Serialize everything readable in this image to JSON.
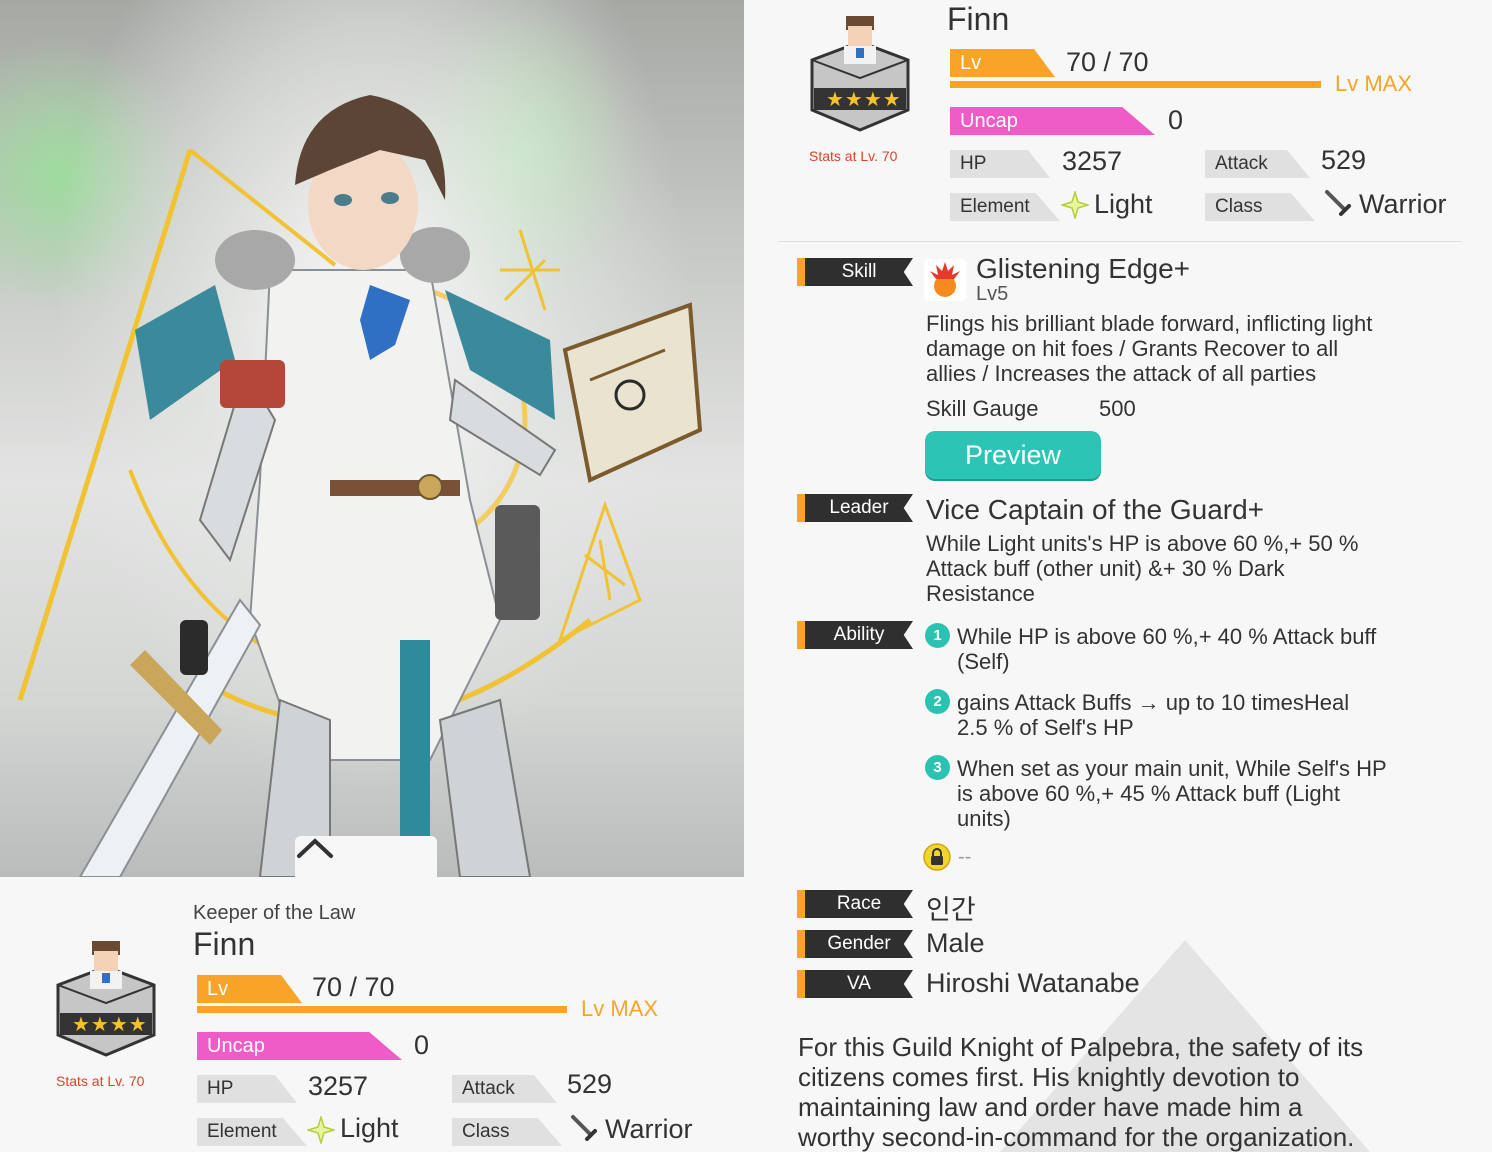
{
  "left": {
    "subtitle": "Keeper of the Law",
    "name": "Finn",
    "stars": "★★★★",
    "stats_at": "Stats at Lv. 70",
    "lv_label": "Lv",
    "lv_value": "70 / 70",
    "lv_max": "Lv MAX",
    "uncap_label": "Uncap",
    "uncap_value": "0",
    "hp_label": "HP",
    "hp_value": "3257",
    "attack_label": "Attack",
    "attack_value": "529",
    "element_label": "Element",
    "element_value": "Light",
    "class_label": "Class",
    "class_value": "Warrior"
  },
  "right": {
    "name": "Finn",
    "stars": "★★★★",
    "stats_at": "Stats at Lv. 70",
    "lv_label": "Lv",
    "lv_value": "70 / 70",
    "lv_max": "Lv MAX",
    "uncap_label": "Uncap",
    "uncap_value": "0",
    "hp_label": "HP",
    "hp_value": "3257",
    "attack_label": "Attack",
    "attack_value": "529",
    "element_label": "Element",
    "element_value": "Light",
    "class_label": "Class",
    "class_value": "Warrior",
    "skill": {
      "label": "Skill",
      "name": "Glistening Edge+",
      "level": "Lv5",
      "desc1": "Flings his brilliant blade forward, inflicting light",
      "desc2": "damage on hit foes / Grants Recover to all",
      "desc3": "allies / Increases the attack of all parties",
      "gauge_label": "Skill Gauge",
      "gauge_value": "500",
      "preview": "Preview"
    },
    "leader": {
      "label": "Leader",
      "name": "Vice Captain of the Guard+",
      "desc1": "While  Light  units's HP is above 60 %,+ 50 %",
      "desc2": "Attack buff (other unit) &+ 30 % Dark",
      "desc3": "Resistance"
    },
    "ability": {
      "label": "Ability",
      "items": [
        {
          "num": "1",
          "line1": "While  HP is above 60 %,+ 40 % Attack buff",
          "line2": "(Self)",
          "line3": ""
        },
        {
          "num": "2",
          "line1": " gains Attack Buffs → up to 10 timesHeal",
          "line2": "2.5 % of Self's HP",
          "line3": ""
        },
        {
          "num": "3",
          "line1": "When set as your main unit, While  Self's HP",
          "line2": "is above 60 %,+ 45 % Attack buff (Light",
          "line3": "units)"
        }
      ],
      "locked": "--"
    },
    "race": {
      "label": "Race",
      "value": "인간"
    },
    "gender": {
      "label": "Gender",
      "value": "Male"
    },
    "va": {
      "label": "VA",
      "value": "Hiroshi Watanabe"
    },
    "bio": {
      "line1": "For this Guild Knight of Palpebra, the safety of its",
      "line2": "citizens comes first. His knightly devotion to",
      "line3": "maintaining law and order have made him a",
      "line4": "worthy second-in-command for the organization."
    }
  },
  "colors": {
    "orange": "#f7a428",
    "pink": "#ef5cc7",
    "teal": "#2cc4b5",
    "dark_label": "#2f2f2f",
    "stats_at_red": "#d6452a"
  }
}
